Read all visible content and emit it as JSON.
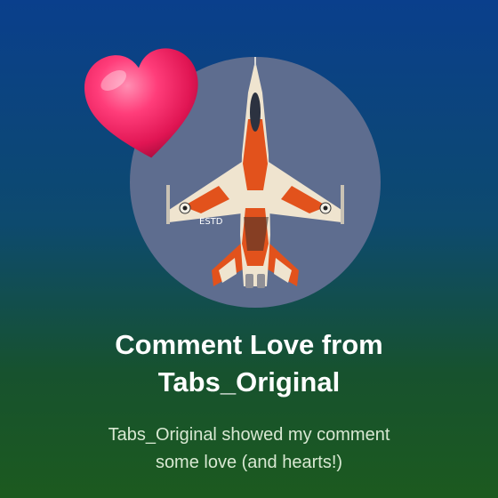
{
  "card": {
    "title_lines": [
      "Comment Love from",
      "Tabs_Original"
    ],
    "subtitle_lines": [
      "Tabs_Original showed my comment",
      "some love (and hearts!)"
    ]
  },
  "avatar": {
    "icon": "fighter-jet-avatar",
    "jet_markings": "ESTD"
  },
  "decoration": {
    "icon": "heart-icon",
    "color": "#e8245f"
  },
  "colors": {
    "background_top": "#0a3f8c",
    "background_bottom": "#1c5a1f",
    "avatar_bg": "#5e6d8f",
    "jet_orange": "#e2521c",
    "jet_cream": "#efe4cf"
  }
}
